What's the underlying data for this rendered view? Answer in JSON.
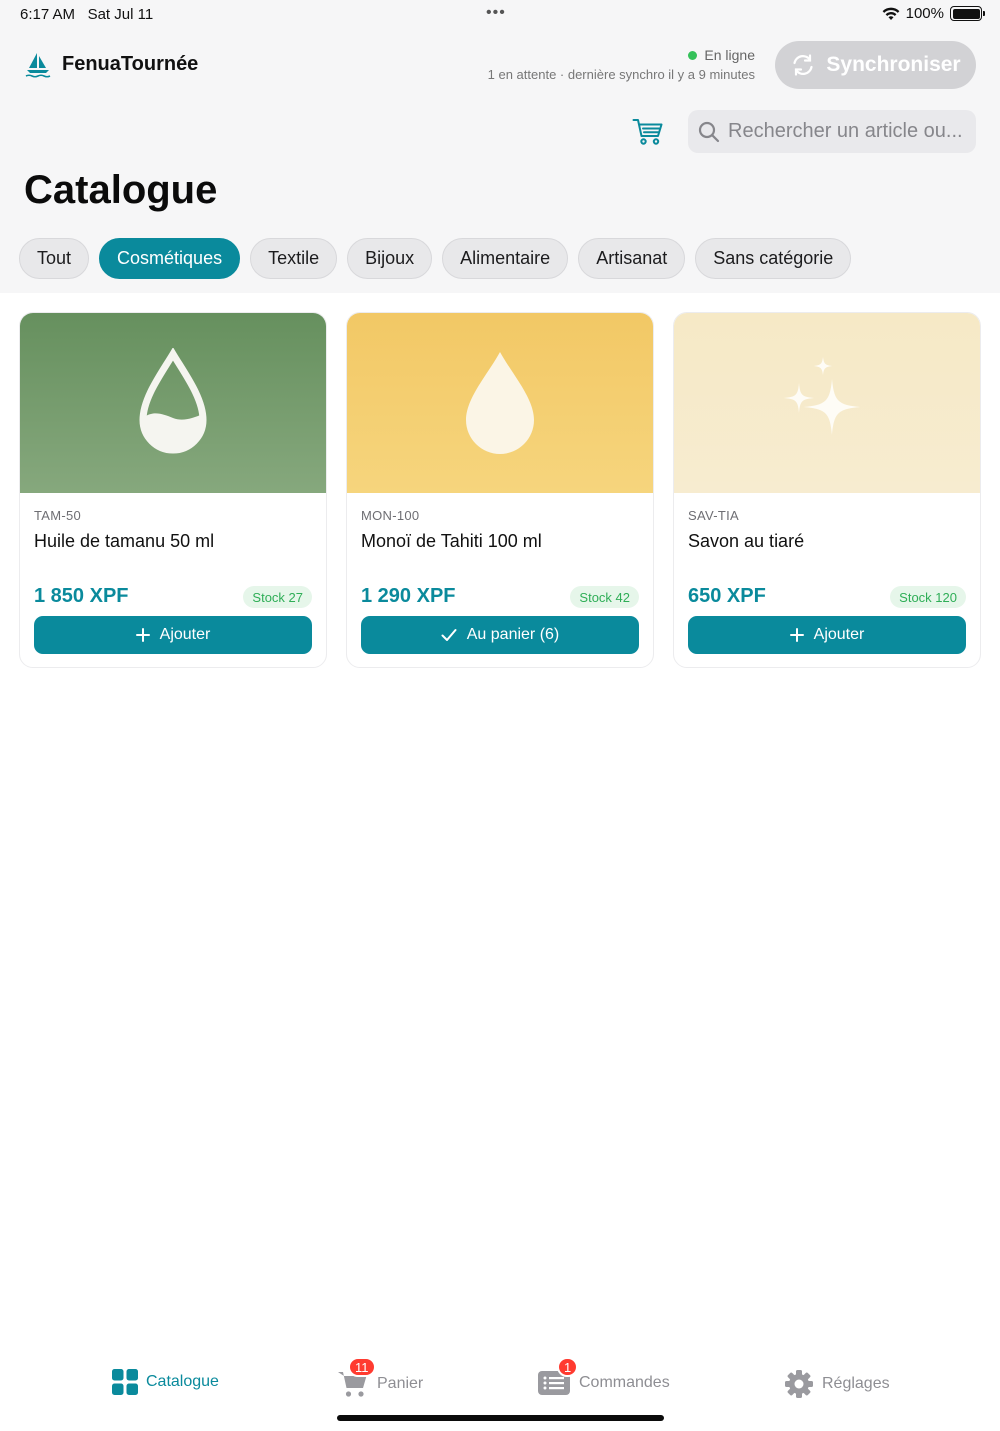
{
  "status_bar": {
    "time": "6:17 AM",
    "date": "Sat Jul 11",
    "battery": "100%"
  },
  "header": {
    "app_name": "FenuaTournée",
    "connection": "En ligne",
    "sync_status": "1 en attente · dernière synchro il y a 9 minutes",
    "sync_button": "Synchroniser",
    "search_placeholder": "Rechercher un article ou..."
  },
  "page_title": "Catalogue",
  "categories": [
    {
      "label": "Tout",
      "active": false
    },
    {
      "label": "Cosmétiques",
      "active": true
    },
    {
      "label": "Textile",
      "active": false
    },
    {
      "label": "Bijoux",
      "active": false
    },
    {
      "label": "Alimentaire",
      "active": false
    },
    {
      "label": "Artisanat",
      "active": false
    },
    {
      "label": "Sans catégorie",
      "active": false
    }
  ],
  "products": [
    {
      "sku": "TAM-50",
      "name": "Huile de tamanu 50 ml",
      "price": "1 850 XPF",
      "stock": "Stock 27",
      "action": "Ajouter",
      "icon": "half-drop-icon",
      "color": "#6e9a68"
    },
    {
      "sku": "MON-100",
      "name": "Monoï de Tahiti 100 ml",
      "price": "1 290 XPF",
      "stock": "Stock 42",
      "action": "Au panier (6)",
      "icon": "drop-icon",
      "color": "#f3cd6e"
    },
    {
      "sku": "SAV-TIA",
      "name": "Savon au tiaré",
      "price": "650 XPF",
      "stock": "Stock 120",
      "action": "Ajouter",
      "icon": "sparkles-icon",
      "color": "#f6e8c2"
    }
  ],
  "tabs": {
    "catalogue": "Catalogue",
    "panier": "Panier",
    "panier_badge": "11",
    "commandes": "Commandes",
    "commandes_badge": "1",
    "reglages": "Réglages"
  },
  "colors": {
    "accent": "#0a8a9c",
    "stock_green": "#2fae57",
    "badge_red": "#ff3b30"
  }
}
